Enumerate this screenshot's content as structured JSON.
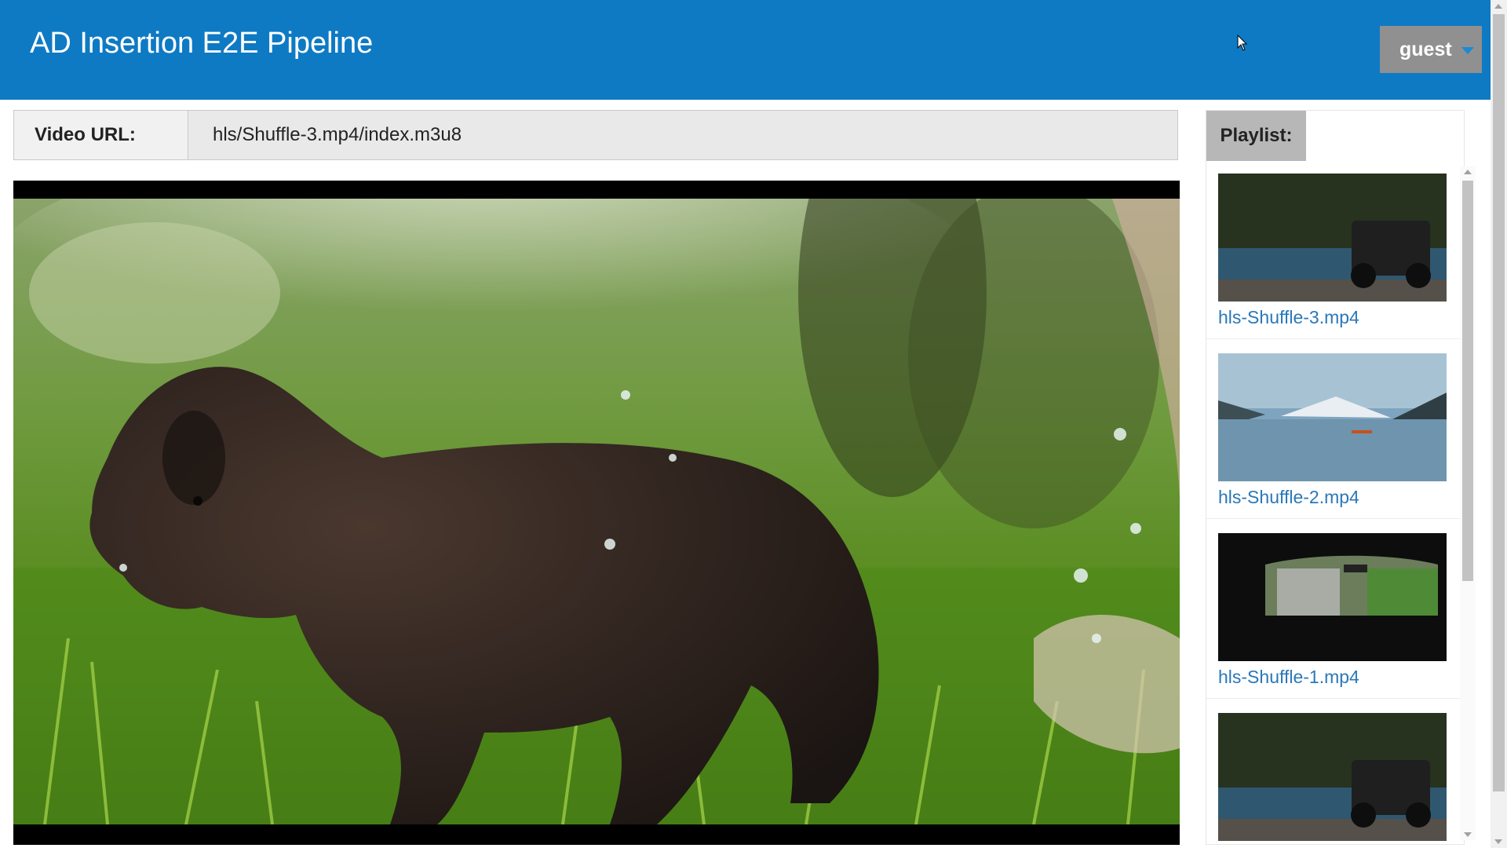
{
  "header": {
    "title": "AD Insertion E2E Pipeline",
    "user_label": "guest",
    "bg_color": "#0e7ac4"
  },
  "url_bar": {
    "label": "Video URL:",
    "value": "hls/Shuffle-3.mp4/index.m3u8"
  },
  "video": {
    "scene": "dark-brown-puppy-walking-in-grass"
  },
  "playlist": {
    "title": "Playlist:",
    "items": [
      {
        "label": "hls-Shuffle-3.mp4",
        "thumb": "jeep-by-lake"
      },
      {
        "label": "hls-Shuffle-2.mp4",
        "thumb": "mountain-lake-reflection"
      },
      {
        "label": "hls-Shuffle-1.mp4",
        "thumb": "car-window-waterfall"
      },
      {
        "label": "",
        "thumb": "jeep-by-lake"
      }
    ]
  },
  "colors": {
    "link": "#2a78b8",
    "user_menu_bg": "#909090"
  },
  "icons": [
    "caret-down-icon",
    "mouse-cursor-icon",
    "scroll-up-icon",
    "scroll-down-icon"
  ]
}
